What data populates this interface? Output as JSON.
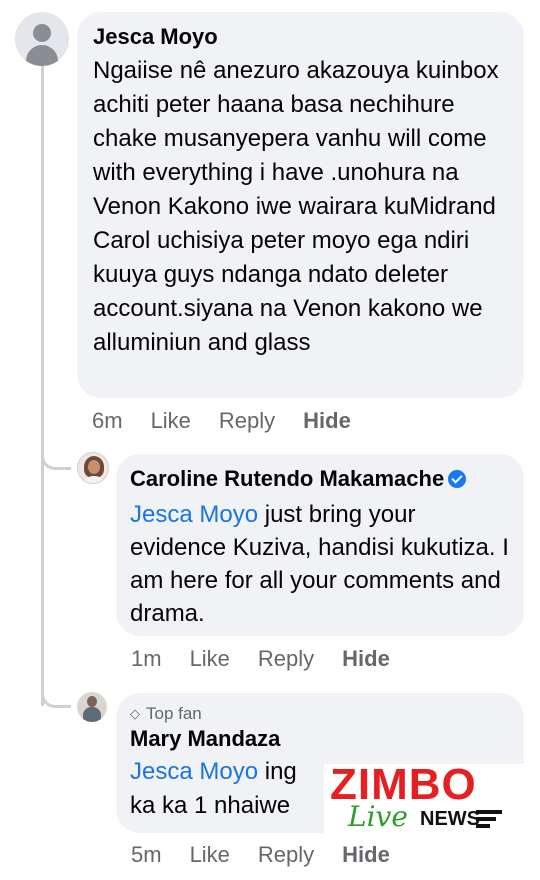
{
  "comments": [
    {
      "author": "Jesca Moyo",
      "text": "Ngaiise nê anezuro akazouya kuinbox achiti peter haana basa nechihure chake musanyepera vanhu will come with everything i have .unohura na Venon Kakono iwe wairara kuMidrand Carol uchisiya peter moyo ega ndiri kuuya guys ndanga ndato deleter account.siyana na Venon kakono we alluminiun and glass",
      "time": "6m",
      "like": "Like",
      "reply": "Reply",
      "hide": "Hide"
    },
    {
      "author": "Caroline Rutendo Makamache",
      "mention": "Jesca Moyo",
      "text": " just bring your evidence Kuziva, handisi kukutiza. I am here for all your comments and drama.",
      "time": "1m",
      "like": "Like",
      "reply": "Reply",
      "hide": "Hide"
    },
    {
      "badge": "Top fan",
      "author": "Mary Mandaza",
      "mention": "Jesca Moyo",
      "text": " ing",
      "text2": "ka ka 1 nhaiwe",
      "time": "5m",
      "like": "Like",
      "reply": "Reply",
      "hide": "Hide"
    }
  ],
  "watermark": {
    "main": "ZIMBO",
    "live": "Live",
    "news": "NEWS"
  },
  "colors": {
    "bubble": "#f0f2f5",
    "mention": "#1b74e4",
    "meta": "#65676b",
    "verified": "#1877f2",
    "logo_red": "#e62020",
    "logo_green": "#2a9d2a"
  }
}
